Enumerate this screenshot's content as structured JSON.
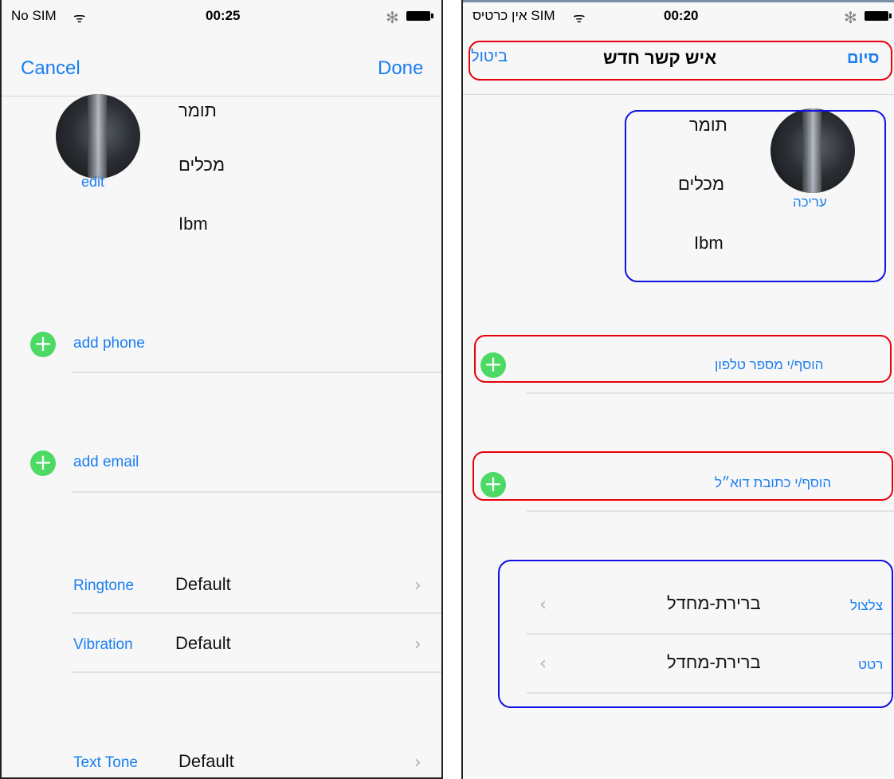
{
  "left": {
    "status": {
      "carrier": "No SIM",
      "wifi": "ᯤ",
      "time": "00:25",
      "bluetooth": "✻"
    },
    "nav": {
      "cancel": "Cancel",
      "done": "Done"
    },
    "contact": {
      "edit": "edit",
      "first_name": "תומר",
      "last_name": "מכלים",
      "company": "Ibm"
    },
    "add_phone": "add phone",
    "add_email": "add email",
    "rows": [
      {
        "label": "Ringtone",
        "value": "Default"
      },
      {
        "label": "Vibration",
        "value": "Default"
      },
      {
        "label": "Text Tone",
        "value": "Default"
      }
    ]
  },
  "right": {
    "status": {
      "carrier": "אין כרטיס SIM",
      "wifi": "ᯤ",
      "time": "00:20",
      "bluetooth": "✻"
    },
    "nav": {
      "cancel": "ביטול",
      "title": "איש קשר חדש",
      "done": "סיום"
    },
    "contact": {
      "edit": "עריכה",
      "first_name": "תומר",
      "last_name": "מכלים",
      "company": "Ibm"
    },
    "add_phone": "הוסף/י מספר טלפון",
    "add_email": "הוסף/י כתובת דוא״ל",
    "rows": [
      {
        "label": "צלצול",
        "value": "ברירת-מחדל"
      },
      {
        "label": "רטט",
        "value": "ברירת-מחדל"
      }
    ]
  },
  "icons": {
    "plus": "+",
    "chevron_right": "›",
    "chevron_left": "‹"
  },
  "colors": {
    "accent": "#1a7ef0",
    "add_green": "#4cd964",
    "annotation_red": "#e8000b",
    "annotation_blue": "#1010e6"
  }
}
